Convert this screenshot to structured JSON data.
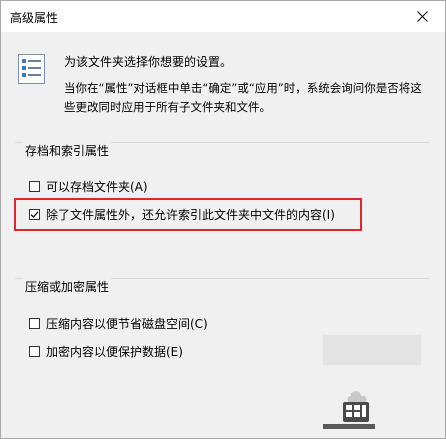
{
  "window": {
    "title": "高级属性",
    "close_glyph": "✕"
  },
  "intro": {
    "line1": "为该文件夹选择你想要的设置。",
    "line2": "当你在“属性”对话框中单击“确定”或“应用”时，系统会询问你是否将这些更改同时应用于所有子文件夹和文件。"
  },
  "archive_group": {
    "title": "存档和索引属性",
    "options": [
      {
        "label": "可以存档文件夹(A)",
        "checked": false
      },
      {
        "label": "除了文件属性外，还允许索引此文件夹中文件的内容(I)",
        "checked": true
      }
    ]
  },
  "compress_group": {
    "title": "压缩或加密属性",
    "options": [
      {
        "label": "压缩内容以便节省磁盘空间(C)",
        "checked": false
      },
      {
        "label": "加密内容以便保护数据(E)",
        "checked": false
      }
    ]
  },
  "icons": {
    "header": "properties-list-icon",
    "close": "close-icon",
    "check": "checkmark-icon",
    "watermark": "watermark-logo-icon"
  },
  "colors": {
    "highlight": "#e0262a",
    "dialog_bg": "#f0f0f0",
    "titlebar_bg": "#ffffff"
  }
}
